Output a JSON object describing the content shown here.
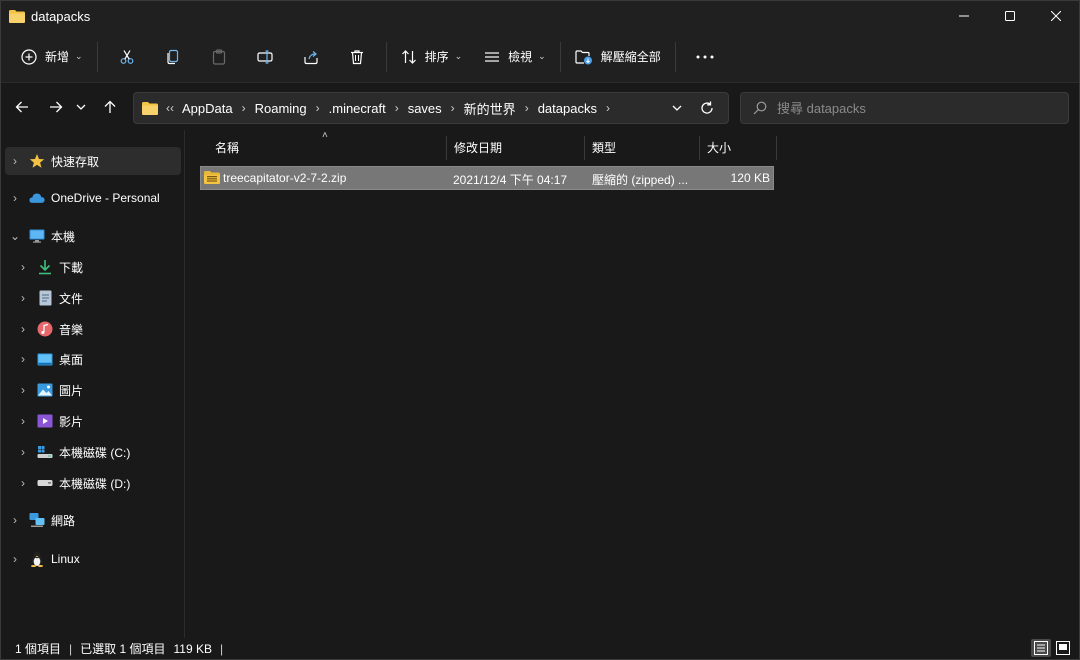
{
  "window": {
    "title": "datapacks"
  },
  "command_bar": {
    "new_label": "新增",
    "sort_label": "排序",
    "view_label": "檢視",
    "extract_all_label": "解壓縮全部"
  },
  "address": {
    "overflow": "‹‹",
    "breadcrumbs": [
      "AppData",
      "Roaming",
      ".minecraft",
      "saves",
      "新的世界",
      "datapacks"
    ]
  },
  "search": {
    "placeholder": "搜尋 datapacks"
  },
  "sidebar": {
    "items": [
      {
        "label": "快速存取",
        "icon": "star-icon"
      },
      {
        "label": "OneDrive - Personal",
        "icon": "cloud-icon"
      },
      {
        "label": "本機",
        "icon": "monitor-icon"
      },
      {
        "label": "下載",
        "icon": "download-icon"
      },
      {
        "label": "文件",
        "icon": "document-icon"
      },
      {
        "label": "音樂",
        "icon": "music-icon"
      },
      {
        "label": "桌面",
        "icon": "desktop-icon"
      },
      {
        "label": "圖片",
        "icon": "picture-icon"
      },
      {
        "label": "影片",
        "icon": "video-icon"
      },
      {
        "label": "本機磁碟 (C:)",
        "icon": "drive-c-icon"
      },
      {
        "label": "本機磁碟 (D:)",
        "icon": "drive-d-icon"
      },
      {
        "label": "網路",
        "icon": "network-icon"
      },
      {
        "label": "Linux",
        "icon": "linux-icon"
      }
    ]
  },
  "columns": {
    "name": "名稱",
    "modified": "修改日期",
    "type": "類型",
    "size": "大小"
  },
  "files": [
    {
      "name": "treecapitator-v2-7-2.zip",
      "modified": "2021/12/4 下午 04:17",
      "type": "壓縮的 (zipped) ...",
      "size": "120 KB"
    }
  ],
  "status": {
    "count": "1 個項目",
    "selected": "已選取 1 個項目",
    "size": "119 KB"
  },
  "colors": {
    "accent_folder": "#f3c343",
    "background": "#191919",
    "selection": "#777777"
  }
}
